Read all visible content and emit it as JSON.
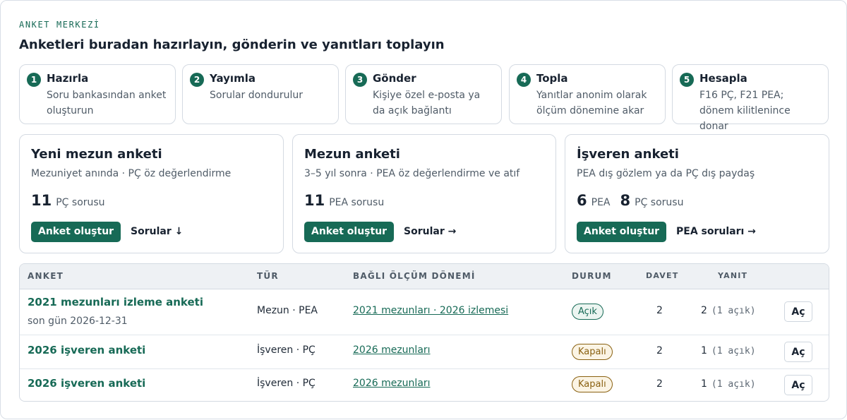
{
  "header": {
    "eyebrow": "ANKET MERKEZİ",
    "title": "Anketleri buradan hazırlayın, gönderin ve yanıtları toplayın"
  },
  "steps": [
    {
      "num": "1",
      "title": "Hazırla",
      "desc": "Soru bankasından anket oluşturun"
    },
    {
      "num": "2",
      "title": "Yayımla",
      "desc": "Sorular dondurulur"
    },
    {
      "num": "3",
      "title": "Gönder",
      "desc": "Kişiye özel e-posta ya da açık bağlantı"
    },
    {
      "num": "4",
      "title": "Topla",
      "desc": "Yanıtlar anonim olarak ölçüm dönemine akar"
    },
    {
      "num": "5",
      "title": "Hesapla",
      "desc": "F16 PÇ, F21 PEA; dönem kilitlenince donar"
    }
  ],
  "cards": [
    {
      "title": "Yeni mezun anketi",
      "subtitle": "Mezuniyet anında · PÇ öz değerlendirme",
      "stats": [
        {
          "num": "11",
          "label": "PÇ sorusu"
        }
      ],
      "create_label": "Anket oluştur",
      "link_label": "Sorular ↓"
    },
    {
      "title": "Mezun anketi",
      "subtitle": "3–5 yıl sonra · PEA öz değerlendirme ve atıf",
      "stats": [
        {
          "num": "11",
          "label": "PEA sorusu"
        }
      ],
      "create_label": "Anket oluştur",
      "link_label": "Sorular →"
    },
    {
      "title": "İşveren anketi",
      "subtitle": "PEA dış gözlem ya da PÇ dış paydaş",
      "stats": [
        {
          "num": "6",
          "label": "PEA"
        },
        {
          "num": "8",
          "label": "PÇ sorusu"
        }
      ],
      "create_label": "Anket oluştur",
      "link_label": "PEA soruları →"
    }
  ],
  "table": {
    "columns": [
      "ANKET",
      "TÜR",
      "BAĞLI ÖLÇÜM DÖNEMİ",
      "DURUM",
      "DAVET",
      "YANIT"
    ],
    "rows": [
      {
        "name": "2021 mezunları izleme anketi",
        "deadline": "son gün 2026-12-31",
        "type": "Mezun · PEA",
        "period": "2021 mezunları · 2026 izlemesi",
        "status": "Açık",
        "status_kind": "open",
        "invites": "2",
        "responses": "2",
        "open_note": "(1 açık)",
        "action": "Aç"
      },
      {
        "name": "2026 işveren anketi",
        "deadline": "",
        "type": "İşveren · PÇ",
        "period": "2026 mezunları",
        "status": "Kapalı",
        "status_kind": "closed",
        "invites": "2",
        "responses": "1",
        "open_note": "(1 açık)",
        "action": "Aç"
      },
      {
        "name": "2026 işveren anketi",
        "deadline": "",
        "type": "İşveren · PÇ",
        "period": "2026 mezunları",
        "status": "Kapalı",
        "status_kind": "closed",
        "invites": "2",
        "responses": "1",
        "open_note": "(1 açık)",
        "action": "Aç"
      }
    ]
  },
  "colors": {
    "accent": "#176a56",
    "closed": "#8a6111"
  }
}
